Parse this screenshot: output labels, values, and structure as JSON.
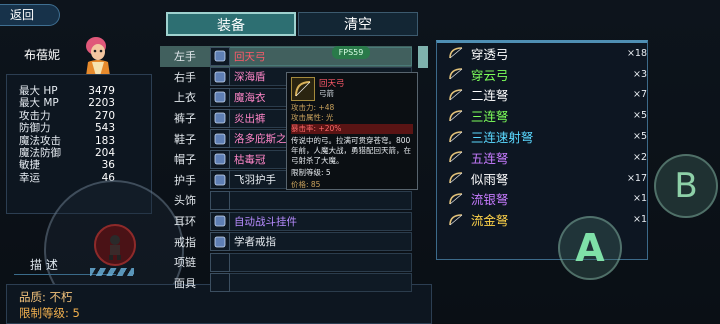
{
  "header": {
    "back_label": "返回"
  },
  "character": {
    "name": "布蓓妮",
    "stats": [
      {
        "label": "最大 HP",
        "value": "3479"
      },
      {
        "label": "最大 MP",
        "value": "2203"
      },
      {
        "label": "攻击力",
        "value": "270"
      },
      {
        "label": "防御力",
        "value": "543"
      },
      {
        "label": "魔法攻击",
        "value": "183"
      },
      {
        "label": "魔法防御",
        "value": "204"
      },
      {
        "label": "敏捷",
        "value": "36"
      },
      {
        "label": "幸运",
        "value": "46"
      }
    ]
  },
  "description": {
    "tab_label": "描 述",
    "quality": "品质: 不朽",
    "level_limit": "限制等级: 5"
  },
  "tabs": {
    "equip": "装备",
    "clear": "清空"
  },
  "fps": "FPS59",
  "slots": [
    {
      "label": "左手",
      "item": "回天弓",
      "color": "#ff5a6a",
      "icon": "bow-icon"
    },
    {
      "label": "右手",
      "item": "深海盾",
      "color": "#ff86c8",
      "icon": "shield-icon"
    },
    {
      "label": "上衣",
      "item": "魔海衣",
      "color": "#ff86c8",
      "icon": "robe-icon"
    },
    {
      "label": "裤子",
      "item": "炎出裤",
      "color": "#ff86c8",
      "icon": "pants-icon"
    },
    {
      "label": "鞋子",
      "item": "洛多庇斯之",
      "color": "#ff86c8",
      "icon": "boots-icon"
    },
    {
      "label": "帽子",
      "item": "枯毒冠",
      "color": "#ff86c8",
      "icon": "crown-icon"
    },
    {
      "label": "护手",
      "item": "飞羽护手",
      "color": "#e8edf2",
      "icon": "glove-icon"
    },
    {
      "label": "头饰",
      "item": "",
      "color": "#e8edf2",
      "icon": ""
    },
    {
      "label": "耳环",
      "item": "自动战斗挂件",
      "color": "#b88cff",
      "icon": "pendant-icon"
    },
    {
      "label": "戒指",
      "item": "学者戒指",
      "color": "#e8edf2",
      "icon": "ring-icon"
    },
    {
      "label": "项链",
      "item": "",
      "color": "#e8edf2",
      "icon": ""
    },
    {
      "label": "面具",
      "item": "",
      "color": "#e8edf2",
      "icon": ""
    }
  ],
  "tooltip": {
    "name": "回天弓",
    "type": "弓箭",
    "attack": "攻击力: +48",
    "element": "攻击属性: 光",
    "crit": "暴击率: +20%",
    "lore": "传说中的弓。拉满可贯穿苍穹。800年前，人魔大战，勇猎配回天箭，在弓射杀了大魔。",
    "level": "限制等级: 5",
    "price": "价格: 85"
  },
  "inventory": [
    {
      "name": "穿透弓",
      "count": "×18",
      "color": "#ffffff"
    },
    {
      "name": "穿云弓",
      "count": "×3",
      "color": "#7dff5a"
    },
    {
      "name": "二连弩",
      "count": "×7",
      "color": "#ffffff"
    },
    {
      "name": "三连弩",
      "count": "×5",
      "color": "#7dff5a"
    },
    {
      "name": "三连速射弩",
      "count": "×5",
      "color": "#5ad8ff"
    },
    {
      "name": "五连弩",
      "count": "×2",
      "color": "#c77bff"
    },
    {
      "name": "似雨弩",
      "count": "×17",
      "color": "#ffffff"
    },
    {
      "name": "流银弩",
      "count": "×1",
      "color": "#c77bff"
    },
    {
      "name": "流金弩",
      "count": "×1",
      "color": "#ffd34a"
    }
  ],
  "buttons": {
    "a": "A",
    "b": "B"
  }
}
